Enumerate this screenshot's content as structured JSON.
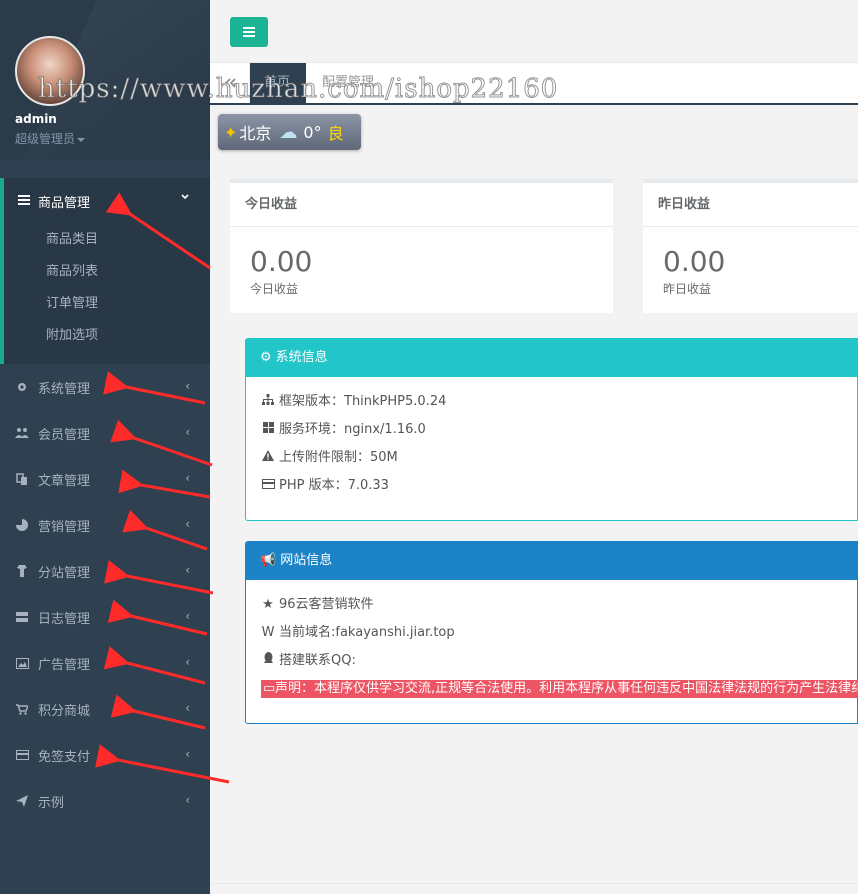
{
  "watermark": "https://www.huzhan.com/ishop22160",
  "user": {
    "name": "admin",
    "role": "超级管理员"
  },
  "sidebar": {
    "active_group": {
      "label": "商品管理",
      "icon": "bars-icon",
      "children": [
        "商品类目",
        "商品列表",
        "订单管理",
        "附加选项"
      ]
    },
    "items": [
      {
        "label": "系统管理",
        "icon": "gear-icon"
      },
      {
        "label": "会员管理",
        "icon": "users-icon"
      },
      {
        "label": "文章管理",
        "icon": "copy-icon"
      },
      {
        "label": "营销管理",
        "icon": "pie-chart-icon"
      },
      {
        "label": "分站管理",
        "icon": "shirt-icon"
      },
      {
        "label": "日志管理",
        "icon": "server-icon"
      },
      {
        "label": "广告管理",
        "icon": "image-icon"
      },
      {
        "label": "积分商城",
        "icon": "cart-icon"
      },
      {
        "label": "免签支付",
        "icon": "credit-card-icon"
      },
      {
        "label": "示例",
        "icon": "paper-plane-icon"
      }
    ]
  },
  "tabs": {
    "home": "首页",
    "config": "配置管理"
  },
  "weather": {
    "city": "北京",
    "temp": "0°",
    "aqi": "良"
  },
  "income": {
    "today": {
      "title": "今日收益",
      "value": "0.00",
      "label": "今日收益"
    },
    "yesterday": {
      "title": "昨日收益",
      "value": "0.00",
      "label": "昨日收益"
    }
  },
  "system_info": {
    "title": "系统信息",
    "rows": [
      "框架版本：ThinkPHP5.0.24",
      "服务环境：nginx/1.16.0",
      "上传附件限制：50M",
      "PHP 版本：7.0.33"
    ]
  },
  "site_info": {
    "title": "网站信息",
    "rows": [
      "96云客营销软件",
      "当前域名:fakayanshi.jiar.top",
      "搭建联系QQ:"
    ],
    "notice": "声明：本程序仅供学习交流,正规等合法使用。利用本程序从事任何违反中国法律法规的行为产生法律纠"
  },
  "colors": {
    "sidebar": "#2f4050",
    "accent": "#1ab394",
    "info": "#23c6c8",
    "primary": "#1c84c6",
    "danger": "#ed5565",
    "arrow": "#ff2a2a"
  }
}
